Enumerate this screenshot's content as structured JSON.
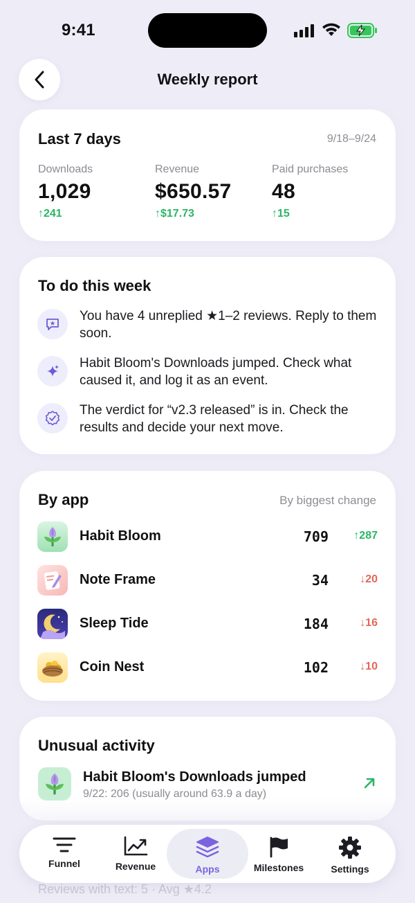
{
  "status_bar": {
    "time": "9:41"
  },
  "header": {
    "title": "Weekly report"
  },
  "summary": {
    "title": "Last 7 days",
    "range": "9/18–9/24",
    "metrics": [
      {
        "label": "Downloads",
        "value": "1,029",
        "change": "↑241"
      },
      {
        "label": "Revenue",
        "value": "$650.57",
        "change": "↑$17.73"
      },
      {
        "label": "Paid purchases",
        "value": "48",
        "change": "↑15"
      }
    ]
  },
  "todo": {
    "title": "To do this week",
    "items": [
      {
        "icon": "review-icon",
        "text": "You have 4 unreplied ★1–2 reviews. Reply to them soon."
      },
      {
        "icon": "sparkle-icon",
        "text": "Habit Bloom's Downloads jumped. Check what caused it, and log it as an event."
      },
      {
        "icon": "verified-badge-icon",
        "text": "The verdict for “v2.3 released” is in. Check the results and decide your next move."
      }
    ]
  },
  "by_app": {
    "title": "By app",
    "sort_label": "By biggest change",
    "apps": [
      {
        "name": "Habit Bloom",
        "value": "709",
        "change": "↑287",
        "direction": "up",
        "icon": "habit-bloom-app-icon"
      },
      {
        "name": "Note Frame",
        "value": "34",
        "change": "↓20",
        "direction": "down",
        "icon": "note-frame-app-icon"
      },
      {
        "name": "Sleep Tide",
        "value": "184",
        "change": "↓16",
        "direction": "down",
        "icon": "sleep-tide-app-icon"
      },
      {
        "name": "Coin Nest",
        "value": "102",
        "change": "↓10",
        "direction": "down",
        "icon": "coin-nest-app-icon"
      }
    ]
  },
  "unusual": {
    "title": "Unusual activity",
    "item_title": "Habit Bloom's Downloads jumped",
    "item_subtitle": "9/22: 206 (usually around 63.9 a day)"
  },
  "behind_text": "Reviews with text: 5 · Avg ★4.2",
  "tabbar": {
    "tabs": [
      {
        "label": "Funnel",
        "icon": "funnel-icon"
      },
      {
        "label": "Revenue",
        "icon": "revenue-chart-icon"
      },
      {
        "label": "Apps",
        "icon": "apps-stack-icon",
        "active": true
      },
      {
        "label": "Milestones",
        "icon": "flag-icon"
      },
      {
        "label": "Settings",
        "icon": "gear-icon"
      }
    ]
  },
  "colors": {
    "positive": "#2bb566",
    "negative": "#e2665a",
    "accent": "#7a63e0",
    "background": "#eeedf7"
  }
}
